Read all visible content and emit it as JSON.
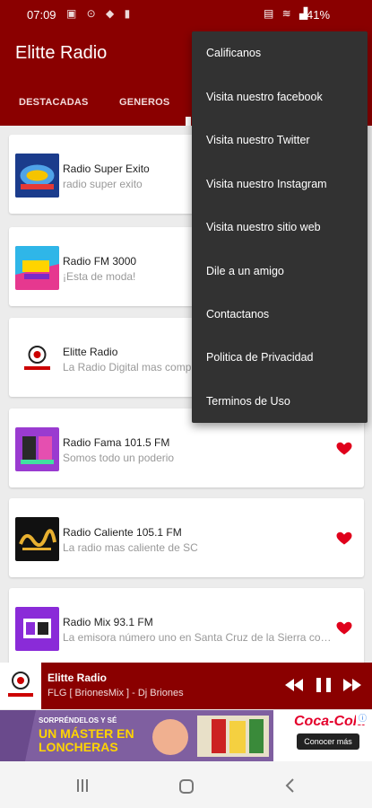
{
  "status_bar": {
    "time": "07:09",
    "battery": "41%"
  },
  "app": {
    "title": "Elitte Radio"
  },
  "tabs": [
    {
      "label": "DESTACADAS"
    },
    {
      "label": "GENEROS"
    }
  ],
  "stations": [
    {
      "name": "Radio Super Exito",
      "description": "radio super exito",
      "favorite": false
    },
    {
      "name": "Radio FM 3000",
      "description": "¡Esta de moda!",
      "favorite": false
    },
    {
      "name": "Elitte Radio",
      "description": "La Radio Digital mas complet",
      "favorite": false
    },
    {
      "name": "Radio Fama 101.5 FM",
      "description": "Somos todo un poderio",
      "favorite": true
    },
    {
      "name": "Radio Caliente 105.1 FM",
      "description": "La radio mas caliente de SC",
      "favorite": true
    },
    {
      "name": "Radio Mix 93.1 FM",
      "description": "La emisora número uno en Santa Cruz de la Sierra con u...",
      "favorite": true
    }
  ],
  "player": {
    "title": "Elitte Radio",
    "subtitle": "FLG [ BrionesMix ] - Dj Briones"
  },
  "ad": {
    "line1": "SORPRÉNDELOS Y SÉ",
    "line2": "UN MÁSTER EN",
    "line3": "LONCHERAS",
    "brand": "Coca-Cola",
    "cta": "Conocer más"
  },
  "menu": {
    "items": [
      {
        "label": "Calificanos"
      },
      {
        "label": "Visita nuestro facebook"
      },
      {
        "label": "Visita nuestro Twitter"
      },
      {
        "label": "Visita nuestro Instagram"
      },
      {
        "label": "Visita nuestro sitio web"
      },
      {
        "label": "Dile a un amigo"
      },
      {
        "label": "Contactanos"
      },
      {
        "label": "Politica de Privacidad"
      },
      {
        "label": "Terminos de Uso"
      }
    ]
  },
  "colors": {
    "primary": "#8a0000",
    "menu_bg": "#323232",
    "favorite": "#e0001b"
  }
}
